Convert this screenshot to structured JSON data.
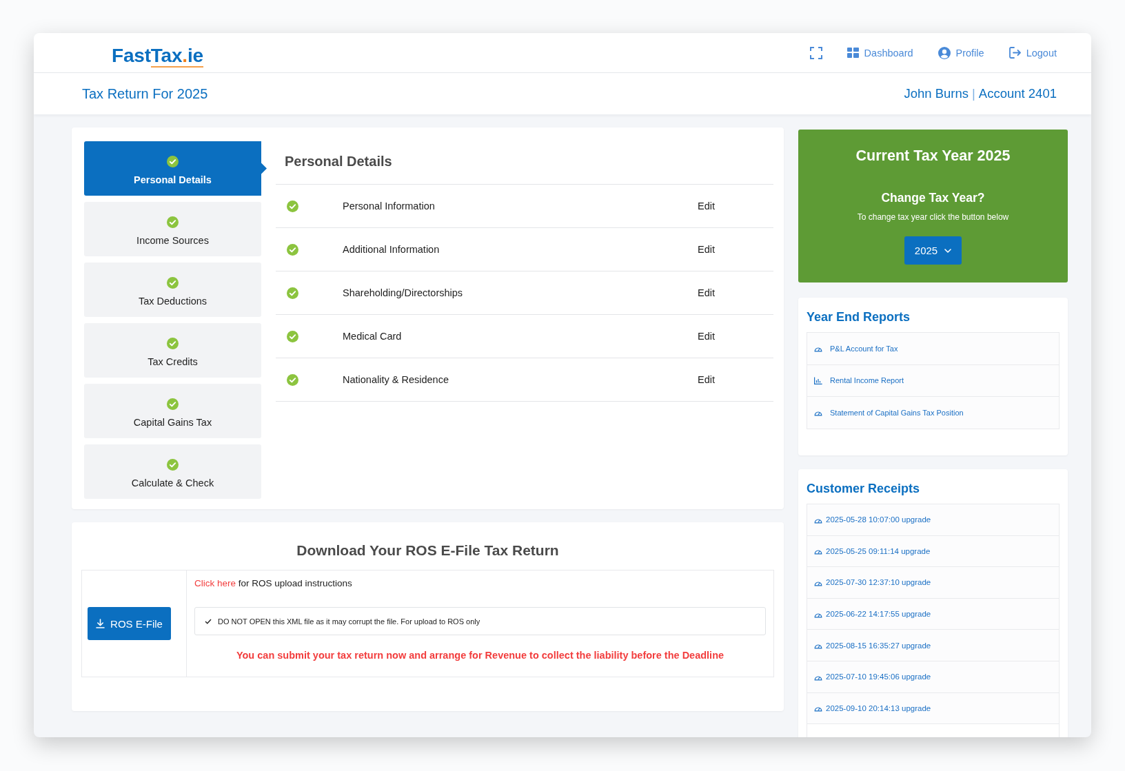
{
  "header": {
    "logo": {
      "prefix": "Fast",
      "suffix": "Tax",
      "dot": ".",
      "domain": "ie"
    },
    "nav": [
      {
        "kind": "dashboard",
        "label": "Dashboard"
      },
      {
        "kind": "profile",
        "label": "Profile"
      },
      {
        "kind": "logout",
        "label": "Logout"
      }
    ]
  },
  "title_bar": {
    "title": "Tax Return For 2025",
    "user_name": "John Burns",
    "separator": "|",
    "account": "Account 2401"
  },
  "steps": [
    {
      "label": "Personal Details",
      "selected": true,
      "completed": true
    },
    {
      "label": "Income Sources",
      "selected": false,
      "completed": true
    },
    {
      "label": "Tax Deductions",
      "selected": false,
      "completed": true
    },
    {
      "label": "Tax Credits",
      "selected": false,
      "completed": true
    },
    {
      "label": "Capital Gains Tax",
      "selected": false,
      "completed": true
    },
    {
      "label": "Calculate & Check",
      "selected": false,
      "completed": true
    }
  ],
  "section": {
    "title": "Personal Details",
    "rows": [
      {
        "label": "Personal Information",
        "completed": true,
        "action": "Edit"
      },
      {
        "label": "Additional Information",
        "completed": true,
        "action": "Edit"
      },
      {
        "label": "Shareholding/Directorships",
        "completed": true,
        "action": "Edit"
      },
      {
        "label": "Medical Card",
        "completed": true,
        "action": "Edit"
      },
      {
        "label": "Nationality & Residence",
        "completed": true,
        "action": "Edit"
      }
    ]
  },
  "download": {
    "title": "Download Your ROS E-File Tax Return",
    "button": "ROS E-File",
    "instructions": {
      "link": "Click here",
      "text": "for ROS upload instructions"
    },
    "notice": "DO NOT OPEN this XML file as it may corrupt the file. For upload to ROS only",
    "warning": "You can submit your tax return now and arrange for Revenue to collect the liability before the Deadline"
  },
  "tax_year": {
    "title": "Current Tax Year 2025",
    "subtitle": "Change Tax Year?",
    "hint": "To change tax year click the button below",
    "selector": "2025"
  },
  "year_end_reports": {
    "title": "Year End Reports",
    "items": [
      {
        "kind": "gauge",
        "label": "P&L Account for Tax"
      },
      {
        "kind": "chart",
        "label": "Rental Income Report"
      },
      {
        "kind": "gauge",
        "label": "Statement of Capital Gains Tax Position"
      }
    ]
  },
  "customer_receipts": {
    "title": "Customer Receipts",
    "items": [
      "2025-05-28 10:07:00 upgrade",
      "2025-05-25 09:11:14 upgrade",
      "2025-07-30 12:37:10 upgrade",
      "2025-06-22 14:17:55 upgrade",
      "2025-08-15 16:35:27 upgrade",
      "2025-07-10 19:45:06 upgrade",
      "2025-09-10 20:14:13 upgrade"
    ]
  }
}
